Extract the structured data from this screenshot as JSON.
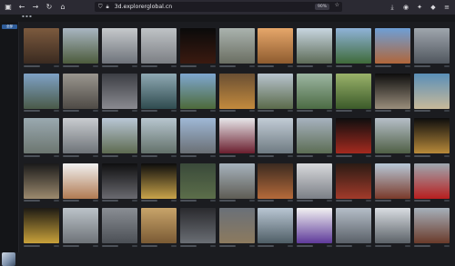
{
  "browser": {
    "url": "3d.explorerglobal.cn",
    "zoom": "90%",
    "icons": [
      "back-icon",
      "forward-icon",
      "reload-icon",
      "home-icon",
      "shield-icon",
      "lock-icon",
      "star-icon",
      "download-icon",
      "extensions-icon",
      "account-icon",
      "menu-icon"
    ]
  },
  "sidebar": {
    "active_tab": "全部",
    "small_label": "全部展馆"
  },
  "tiles": [
    {
      "top": "#7c5a3e",
      "bottom": "#3a2a20"
    },
    {
      "top": "#a9b6c2",
      "bottom": "#4c5b3c"
    },
    {
      "top": "#c6c9cc",
      "bottom": "#6e737a"
    },
    {
      "top": "#bfc3c6",
      "bottom": "#7c7f84"
    },
    {
      "top": "#0a0a0a",
      "bottom": "#3b1a10"
    },
    {
      "top": "#aab3ae",
      "bottom": "#6a6e62"
    },
    {
      "top": "#e6a76a",
      "bottom": "#8e5b2f"
    },
    {
      "top": "#c8d6e0",
      "bottom": "#5e6c58"
    },
    {
      "top": "#8fb3d8",
      "bottom": "#3f6a3a"
    },
    {
      "top": "#6e9fd6",
      "bottom": "#b0663a"
    },
    {
      "top": "#9fa6ad",
      "bottom": "#50565e"
    },
    {
      "top": "#7fa2c6",
      "bottom": "#4a5a48"
    },
    {
      "top": "#9a968f",
      "bottom": "#4e4a45"
    },
    {
      "top": "#3c3e44",
      "bottom": "#8a8a90"
    },
    {
      "top": "#8fa9b3",
      "bottom": "#2f4b4f"
    },
    {
      "top": "#7fa7d0",
      "bottom": "#4d6a3a"
    },
    {
      "top": "#6a4f33",
      "bottom": "#c38a3d"
    },
    {
      "top": "#b8c4cf",
      "bottom": "#5a6a4a"
    },
    {
      "top": "#9db6a2",
      "bottom": "#4c6b44"
    },
    {
      "top": "#9ab26a",
      "bottom": "#3b5a2a"
    },
    {
      "top": "#0d0d0d",
      "bottom": "#9a8e7c"
    },
    {
      "top": "#5a8fb8",
      "bottom": "#c8b99a"
    },
    {
      "top": "#9aa9b0",
      "bottom": "#6c7670"
    },
    {
      "top": "#c9ccd0",
      "bottom": "#6e7378"
    },
    {
      "top": "#b9c7d6",
      "bottom": "#5d6a50"
    },
    {
      "top": "#b7c6cf",
      "bottom": "#63716a"
    },
    {
      "top": "#9fb8d6",
      "bottom": "#6a6f74"
    },
    {
      "top": "#e7e7ea",
      "bottom": "#6a1e2e"
    },
    {
      "top": "#c2ccd6",
      "bottom": "#6f7b82"
    },
    {
      "top": "#a7b2bf",
      "bottom": "#5c6d54"
    },
    {
      "top": "#0e0e0e",
      "bottom": "#a52a1f"
    },
    {
      "top": "#b6bfc8",
      "bottom": "#4f5f45"
    },
    {
      "top": "#0d0d0d",
      "bottom": "#b88a3a"
    },
    {
      "top": "#1a1a1a",
      "bottom": "#9c8a6e"
    },
    {
      "top": "#f1f1f1",
      "bottom": "#b07a52"
    },
    {
      "top": "#0f0f10",
      "bottom": "#6a6a70"
    },
    {
      "top": "#0c0c0c",
      "bottom": "#c9a44a"
    },
    {
      "top": "#3a4a3a",
      "bottom": "#5c6e4a"
    },
    {
      "top": "#a7b3bd",
      "bottom": "#5e5c54"
    },
    {
      "top": "#3b2a20",
      "bottom": "#b56a3a"
    },
    {
      "top": "#d8d9dc",
      "bottom": "#7b7f86"
    },
    {
      "top": "#2b1b14",
      "bottom": "#a23a2a"
    },
    {
      "top": "#b8c8d8",
      "bottom": "#7a3a2a"
    },
    {
      "top": "#9ea8b0",
      "bottom": "#b81e1e"
    },
    {
      "top": "#1d1a14",
      "bottom": "#c9a23a"
    },
    {
      "top": "#bcc3c9",
      "bottom": "#6e7378"
    },
    {
      "top": "#8a8e94",
      "bottom": "#4b4f55"
    },
    {
      "top": "#c8a46a",
      "bottom": "#7a5a34"
    },
    {
      "top": "#2a2a2e",
      "bottom": "#6a6e74"
    },
    {
      "top": "#6a7078",
      "bottom": "#8c7a5e"
    },
    {
      "top": "#b9c6d3",
      "bottom": "#4f5e66"
    },
    {
      "top": "#f2f2f2",
      "bottom": "#5e3a9a"
    },
    {
      "top": "#b5bec8",
      "bottom": "#5a6068"
    },
    {
      "top": "#d9dde2",
      "bottom": "#5c6268"
    },
    {
      "top": "#a6b0ba",
      "bottom": "#6a3a2a"
    }
  ]
}
